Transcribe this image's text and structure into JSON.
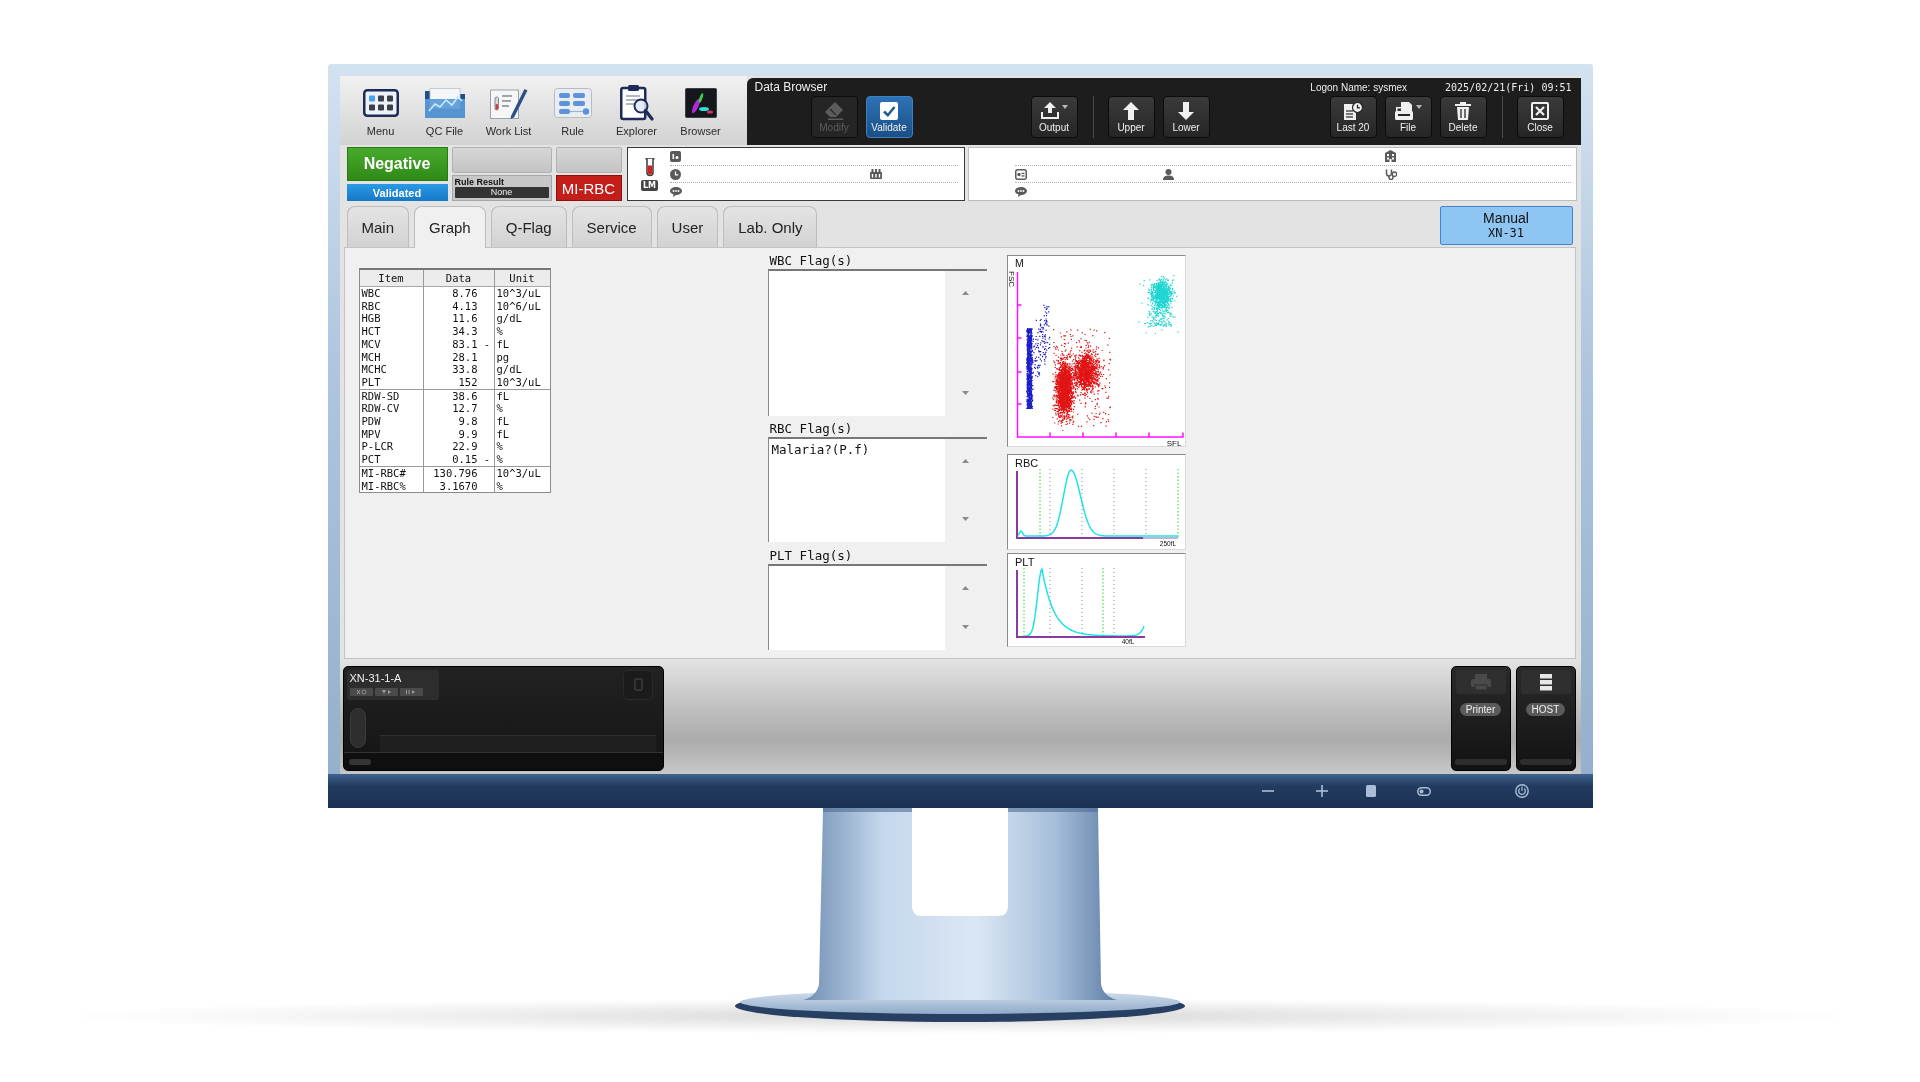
{
  "apps": [
    {
      "label": "Menu"
    },
    {
      "label": "QC File"
    },
    {
      "label": "Work List"
    },
    {
      "label": "Rule"
    },
    {
      "label": "Explorer"
    },
    {
      "label": "Browser"
    }
  ],
  "browser_bar": {
    "title": "Data Browser",
    "logon": "Logon Name: sysmex",
    "datetime": "2025/02/21(Fri) 09:51",
    "groups": [
      [
        {
          "label": "Modify",
          "disabled": true,
          "active": false,
          "dropdown": false
        },
        {
          "label": "Validate",
          "disabled": false,
          "active": true,
          "dropdown": false
        }
      ],
      [
        {
          "label": "Output",
          "disabled": false,
          "active": false,
          "dropdown": true
        }
      ],
      [
        {
          "label": "Upper",
          "disabled": false,
          "active": false,
          "dropdown": false
        },
        {
          "label": "Lower",
          "disabled": false,
          "active": false,
          "dropdown": false
        }
      ],
      [
        {
          "label": "Last 20",
          "disabled": false,
          "active": false,
          "dropdown": false
        },
        {
          "label": "File",
          "disabled": false,
          "active": false,
          "dropdown": true
        },
        {
          "label": "Delete",
          "disabled": false,
          "active": false,
          "dropdown": false
        }
      ],
      [
        {
          "label": "Close",
          "disabled": false,
          "active": false,
          "dropdown": false
        }
      ]
    ]
  },
  "summary": {
    "judgment": "Negative",
    "validation": "Validated",
    "rule_result_label": "Rule Result",
    "rule_result": "None",
    "flag": "MI-RBC",
    "tube_label": "LM"
  },
  "tabs": [
    {
      "label": "Main",
      "selected": false
    },
    {
      "label": "Graph",
      "selected": true
    },
    {
      "label": "Q-Flag",
      "selected": false
    },
    {
      "label": "Service",
      "selected": false
    },
    {
      "label": "User",
      "selected": false
    },
    {
      "label": "Lab. Only",
      "selected": false
    }
  ],
  "mode_button": {
    "mode": "Manual",
    "model": "XN-31"
  },
  "results_table": {
    "columns": [
      "Item",
      "Data",
      "Unit"
    ],
    "groups": [
      [
        {
          "item": "WBC",
          "data": "8.76",
          "unit": "10^3/uL"
        },
        {
          "item": "RBC",
          "data": "4.13",
          "unit": "10^6/uL"
        },
        {
          "item": "HGB",
          "data": "11.6",
          "unit": "g/dL"
        },
        {
          "item": "HCT",
          "data": "34.3",
          "unit": "%"
        },
        {
          "item": "MCV",
          "data": "83.1",
          "flag": "-",
          "unit": "fL"
        },
        {
          "item": "MCH",
          "data": "28.1",
          "unit": "pg"
        },
        {
          "item": "MCHC",
          "data": "33.8",
          "unit": "g/dL"
        },
        {
          "item": "PLT",
          "data": "152",
          "unit": "10^3/uL"
        }
      ],
      [
        {
          "item": "RDW-SD",
          "data": "38.6",
          "unit": "fL"
        },
        {
          "item": "RDW-CV",
          "data": "12.7",
          "unit": "%"
        },
        {
          "item": "PDW",
          "data": "9.8",
          "unit": "fL"
        },
        {
          "item": "MPV",
          "data": "9.9",
          "unit": "fL"
        },
        {
          "item": "P-LCR",
          "data": "22.9",
          "unit": "%"
        },
        {
          "item": "PCT",
          "data": "0.15",
          "flag": "-",
          "unit": "%"
        }
      ],
      [
        {
          "item": "MI-RBC#",
          "data": "130.796",
          "unit": "10^3/uL"
        },
        {
          "item": "MI-RBC%",
          "data": "3.1670",
          "unit": "%"
        }
      ]
    ]
  },
  "flag_panels": [
    {
      "title": "WBC Flag(s)"
    },
    {
      "title": "RBC Flag(s)",
      "items": [
        "Malaria?(P.f)"
      ]
    },
    {
      "title": "PLT Flag(s)"
    }
  ],
  "graphs": [
    {
      "kind": "scatter",
      "title": "M",
      "y_axis": "FSC",
      "x_axis": "SFL"
    },
    {
      "kind": "histogram",
      "title": "RBC",
      "x_axis": "250fL"
    },
    {
      "kind": "histogram",
      "title": "PLT",
      "x_axis": "40fL"
    }
  ],
  "analyzer": {
    "name": "XN-31-1-A"
  },
  "connections": [
    {
      "label": "Printer",
      "connected": false
    },
    {
      "label": "HOST",
      "connected": true
    }
  ]
}
